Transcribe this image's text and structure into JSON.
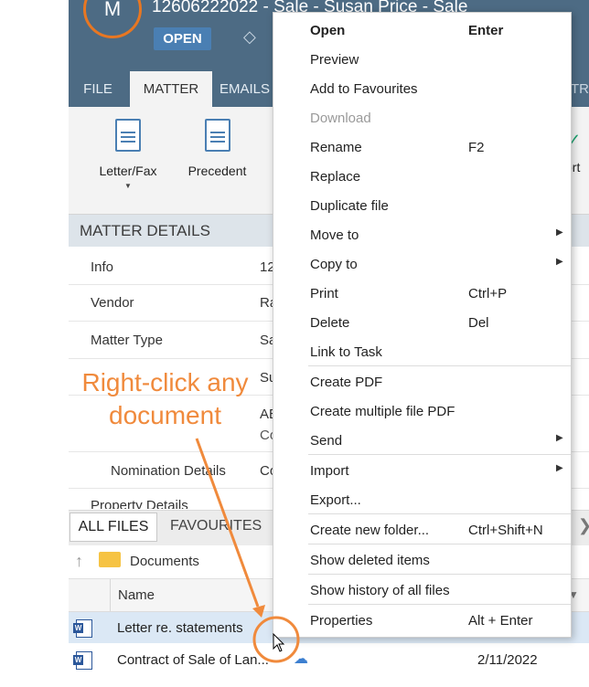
{
  "header": {
    "avatar": "M",
    "title": "12606222022 - Sale - Susan Price - Sale",
    "status": "OPEN"
  },
  "tabs": [
    "FILE",
    "MATTER",
    "EMAILS",
    "TRA"
  ],
  "ribbon": {
    "letter_fax": "Letter/Fax",
    "precedent": "Precedent",
    "right_partial": "ort"
  },
  "matter_details": {
    "title": "MATTER DETAILS",
    "rows": [
      {
        "label": "Info",
        "value": "12"
      },
      {
        "label": "Vendor",
        "value": "Ra"
      },
      {
        "label": "Matter Type",
        "value": "Sa"
      },
      {
        "label": "",
        "value": "Su"
      },
      {
        "label": "",
        "value": "AE"
      },
      {
        "label": "",
        "value": "Co"
      },
      {
        "label": "Nomination Details",
        "value": "Co"
      },
      {
        "label": "Property Details",
        "value": ""
      }
    ]
  },
  "annotation": {
    "callout": "Right-click any document"
  },
  "files": {
    "tabs": {
      "all_files": "ALL FILES",
      "favourites": "FAVOURITES"
    },
    "folder": "Documents",
    "column_name": "Name",
    "rows": [
      {
        "name": "Letter re. statements",
        "date": ""
      },
      {
        "name": "Contract of Sale of Lan...",
        "date": "2/11/2022"
      }
    ]
  },
  "context_menu": {
    "items": [
      {
        "label": "Open",
        "shortcut": "Enter"
      },
      {
        "label": "Preview",
        "shortcut": ""
      },
      {
        "label": "Add to Favourites",
        "shortcut": ""
      },
      {
        "label": "Download",
        "shortcut": ""
      },
      {
        "label": "Rename",
        "shortcut": "F2"
      },
      {
        "label": "Replace",
        "shortcut": ""
      },
      {
        "label": "Duplicate file",
        "shortcut": ""
      },
      {
        "label": "Move to",
        "shortcut": ""
      },
      {
        "label": "Copy to",
        "shortcut": ""
      },
      {
        "label": "Print",
        "shortcut": "Ctrl+P"
      },
      {
        "label": "Delete",
        "shortcut": "Del"
      },
      {
        "label": "Link to Task",
        "shortcut": ""
      },
      {
        "label": "Create PDF",
        "shortcut": ""
      },
      {
        "label": "Create multiple file PDF",
        "shortcut": ""
      },
      {
        "label": "Send",
        "shortcut": ""
      },
      {
        "label": "Import",
        "shortcut": ""
      },
      {
        "label": "Export...",
        "shortcut": ""
      },
      {
        "label": "Create new folder...",
        "shortcut": "Ctrl+Shift+N"
      },
      {
        "label": "Show deleted items",
        "shortcut": ""
      },
      {
        "label": "Show history of all files",
        "shortcut": ""
      },
      {
        "label": "Properties",
        "shortcut": "Alt + Enter"
      }
    ]
  },
  "colors": {
    "header_bg": "#4d6b84",
    "accent_orange": "#f08a3c",
    "selected_row": "#dbe8f5",
    "status_badge": "#4a7fb3"
  }
}
